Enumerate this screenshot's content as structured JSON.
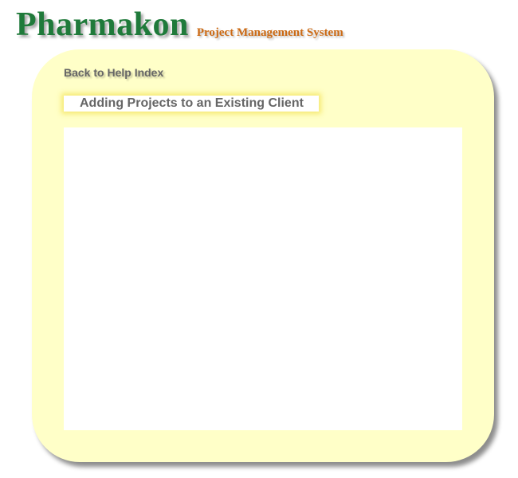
{
  "header": {
    "brand": "Pharmakon",
    "subtitle": "Project Management System"
  },
  "nav": {
    "back_link": "Back to Help Index"
  },
  "page": {
    "title": "Adding Projects to an Existing Client"
  },
  "colors": {
    "brand_green": "#1f7a3a",
    "subtitle_orange": "#cc6a14",
    "panel_yellow": "#ffffc8",
    "text_gray": "#666666"
  }
}
